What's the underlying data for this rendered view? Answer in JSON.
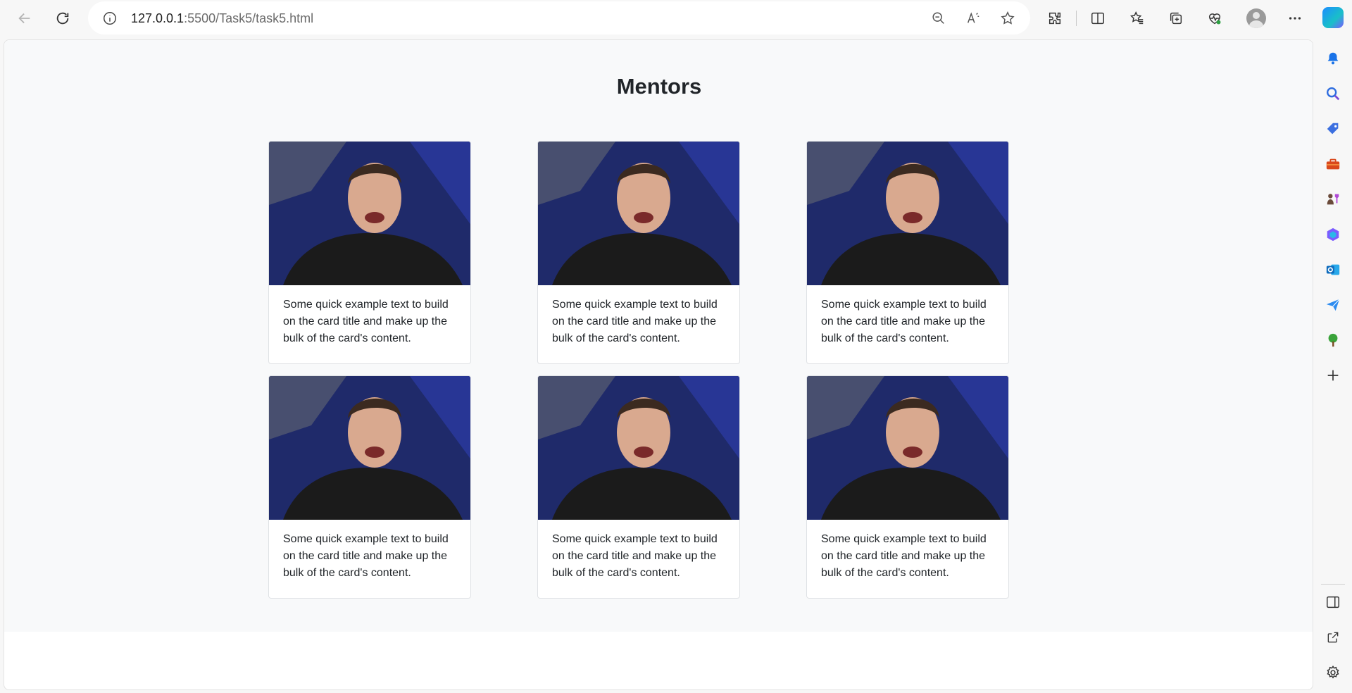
{
  "browser": {
    "url_host": "127.0.0.1",
    "url_rest": ":5500/Task5/task5.html"
  },
  "page": {
    "title": "Mentors"
  },
  "cards": [
    {
      "text": "Some quick example text to build on the card title and make up the bulk of the card's content."
    },
    {
      "text": "Some quick example text to build on the card title and make up the bulk of the card's content."
    },
    {
      "text": "Some quick example text to build on the card title and make up the bulk of the card's content."
    },
    {
      "text": "Some quick example text to build on the card title and make up the bulk of the card's content."
    },
    {
      "text": "Some quick example text to build on the card title and make up the bulk of the card's content."
    },
    {
      "text": "Some quick example text to build on the card title and make up the bulk of the card's content."
    }
  ],
  "icons": {
    "toolbar": [
      "back-icon",
      "refresh-icon",
      "info-icon",
      "zoom-out-icon",
      "read-aloud-icon",
      "favorite-star-icon",
      "extensions-icon",
      "split-screen-icon",
      "favorites-icon",
      "collections-icon",
      "browser-essentials-icon",
      "profile-avatar",
      "more-options-icon",
      "copilot-icon"
    ],
    "sidebar": [
      "notifications-icon",
      "search-icon",
      "shopping-icon",
      "tools-icon",
      "games-icon",
      "microsoft-365-icon",
      "outlook-icon",
      "drop-icon",
      "tree-icon",
      "add-icon",
      "sidebar-toggle-icon",
      "external-link-icon",
      "settings-icon"
    ]
  },
  "colors": {
    "page_background": "#f8f9fa",
    "card_border": "#dfe2e5",
    "text": "#212529"
  }
}
